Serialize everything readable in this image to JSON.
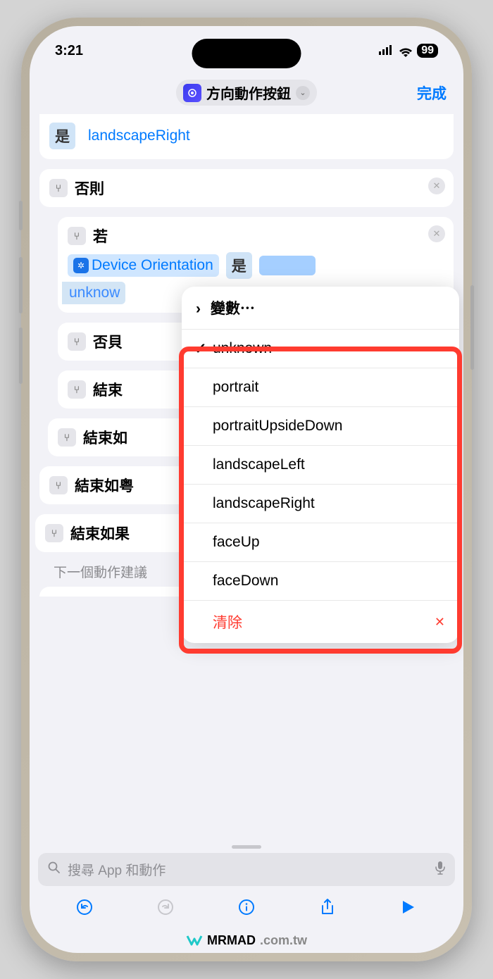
{
  "status": {
    "time": "3:21",
    "battery": "99"
  },
  "nav": {
    "title": "方向動作按鈕",
    "done": "完成"
  },
  "partial_top": {
    "is_label": "是",
    "value": "landscapeRight"
  },
  "card_else1": {
    "label": "否則"
  },
  "card_if": {
    "label": "若",
    "variable": "Device Orientation",
    "condition": "是",
    "value": "unknow"
  },
  "card_else2": {
    "label": "否貝"
  },
  "card_end1": {
    "label": "結束"
  },
  "card_end2": {
    "label": "結束如"
  },
  "card_end3": {
    "label": "結束如粤"
  },
  "card_end4": {
    "label": "結束如果"
  },
  "picker": {
    "variables_label": "變數⋯",
    "options": [
      "unknown",
      "portrait",
      "portraitUpsideDown",
      "landscapeLeft",
      "landscapeRight",
      "faceUp",
      "faceDown"
    ],
    "clear": "清除"
  },
  "suggestions": {
    "label": "下一個動作建議"
  },
  "search": {
    "placeholder": "搜尋 App 和動作"
  },
  "watermark": {
    "brand": "MRMAD",
    "domain": ".com.tw"
  }
}
